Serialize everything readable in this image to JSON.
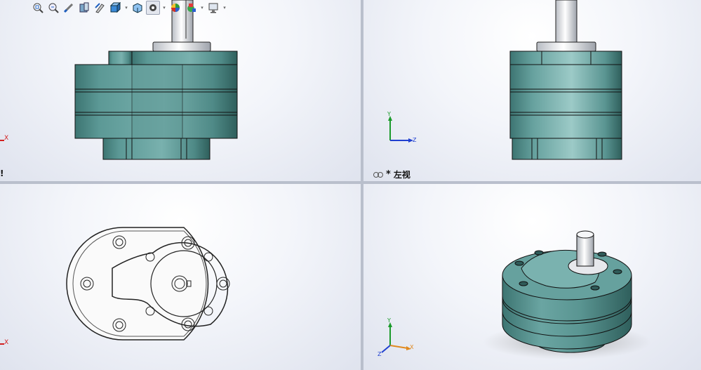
{
  "toolbar": {
    "icons": [
      "zoom-to-fit-icon",
      "zoom-to-area-icon",
      "previous-view-icon",
      "section-view-icon",
      "dynamic-annotation-icon",
      "view-orientation-icon",
      "display-style-icon",
      "hide-show-items-icon",
      "edit-appearance-icon",
      "apply-scene-icon",
      "view-settings-icon"
    ]
  },
  "viewports": {
    "front": {
      "label": "!"
    },
    "left": {
      "prefix": "*",
      "label": "左视"
    },
    "top": {},
    "iso": {}
  },
  "triad": {
    "x": "X",
    "y": "Y",
    "z": "Z"
  },
  "colors": {
    "body_teal": "#5f9c9a",
    "body_teal_dark": "#3f7774",
    "shaft": "#e6e8ec",
    "axis_x": "#d22020",
    "axis_y": "#1a9a2a",
    "axis_z": "#2040d0",
    "axis_z_iso": "#e08a20"
  }
}
